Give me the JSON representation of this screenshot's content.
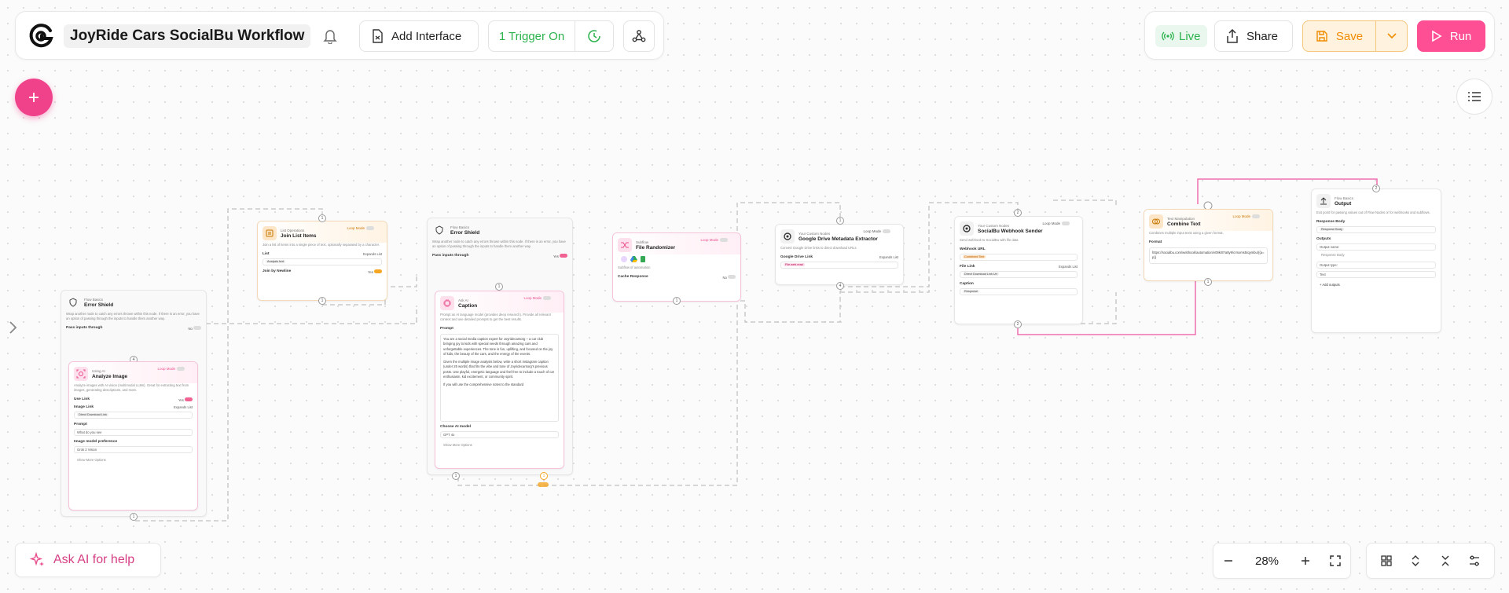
{
  "header": {
    "workflow_title": "JoyRide Cars SocialBu Workflow",
    "add_interface": "Add Interface",
    "trigger": "1 Trigger On",
    "live": "Live",
    "share": "Share",
    "save": "Save",
    "run": "Run"
  },
  "footer": {
    "ask_ai": "Ask AI for help",
    "zoom": "28%"
  },
  "colors": {
    "accent": "#f0418b",
    "live_green": "#2bb24c",
    "save_orange": "#f5a623",
    "run_pink": "#ff4f94"
  },
  "nodes": {
    "error_shield_1": {
      "category": "Flow Basics",
      "title": "Error Shield",
      "desc": "Wrap another node to catch any errors thrown within this node. If there is an error, you have an option of passing through the inputs to handle them another way.",
      "pass_label": "Pass inputs through",
      "pass_value": "No",
      "port": "4",
      "bottom_port": "1"
    },
    "analyze_image": {
      "category": "Using AI",
      "title": "Analyze Image",
      "loop": "Loop Mode",
      "desc": "Analyze images with AI vision (multimodal LLMs). Great for extracting text from images, generating descriptions, and more.",
      "use_link_label": "Use Link",
      "use_link_value": "Yes",
      "image_link_label": "Image Link",
      "expand": "Expands List",
      "image_link_chip": "Direct Download Link",
      "prompt_label": "Prompt",
      "prompt_value": "What do you see",
      "model_label": "Image model preference",
      "model_value": "Grok 2 Vision",
      "more": "Show More Options"
    },
    "join_list": {
      "category": "List Operations",
      "title": "Join List Items",
      "loop": "Loop Mode",
      "desc": "Join a list of items into a single piece of text, optionally separated by a character.",
      "list_label": "List",
      "expand": "Expands List",
      "list_chip": "Analysis text",
      "join_label": "Join by Newline",
      "join_value": "Yes",
      "port_top": "1",
      "port_bottom": "1"
    },
    "error_shield_2": {
      "category": "Flow Basics",
      "title": "Error Shield",
      "desc": "Wrap another node to catch any errors thrown within this node. If there is an error, you have an option of passing through the inputs to handle them another way.",
      "pass_label": "Pass inputs through",
      "pass_value": "Yes",
      "port": "1"
    },
    "caption": {
      "category": "Ask AI",
      "title": "Caption",
      "loop": "Loop Mode",
      "desc": "Prompt an AI language model (provides deep research). Provide all relevant context and use detailed prompts to get the best results.",
      "prompt_label": "Prompt",
      "prompt_p1": "You are a social media caption expert for Joyridecarsorg – a car club bringing joy to kids with special needs through amazing cars and unforgettable experiences. The tone is fun, uplifting, and focused on the joy of kids, the beauty of the cars, and the energy of the events.",
      "prompt_p2": "Given the multiple image analysis below, write a short Instagram caption (under 25 words) that fits the vibe and tone of Joyridecarsorg's previous posts. Use playful, energetic language and feel free to include a touch of car enthusiasm, kid excitement, or community spirit.",
      "prompt_p3": "If you will use the comprehensive notes to the standard",
      "model_label": "Choose AI model",
      "model_value": "GPT 4o",
      "more": "Show More Options",
      "port_left": "1",
      "port_right": "1"
    },
    "file_randomizer": {
      "category": "Subflow",
      "title": "File Randomizer",
      "loop": "Loop Mode",
      "sub": "Subflow of automation",
      "cache_label": "Cache Response",
      "cache_value": "No",
      "port": "1"
    },
    "gdrive": {
      "category": "Your Custom Nodes",
      "title": "Google Drive Metadata Extractor",
      "loop": "Loop Mode",
      "desc": "Convert Google Drive links to direct download URLs",
      "link_label": "Google Drive Link",
      "expand": "Expands List",
      "link_chip": "File.web.read",
      "port_top": "1",
      "port_bottom": "4"
    },
    "socialbu": {
      "category": "Your Custom Nodes",
      "title": "SocialBu Webhook Sender",
      "loop": "Loop Mode",
      "desc": "Send webhook to SocialBu with file data",
      "webhook_label": "Webhook URL",
      "webhook_chip": "Combined Text",
      "file_label": "File Link",
      "expand": "Expands List",
      "file_chip": "Direct Download Link Url",
      "caption_label": "Caption",
      "caption_chip": "Response",
      "port_top": "2",
      "port_bottom": "2"
    },
    "combine": {
      "category": "Text Manipulation",
      "title": "Combine Text",
      "loop": "Loop Mode",
      "desc": "Combines multiple input texts using a given format.",
      "format_label": "Format",
      "format_value": "https://socialbu.com/webhook/automation/v09kr8?a8y9/crmxms5/qymbu/{{a=p}}",
      "port_bottom": "1"
    },
    "output": {
      "category": "Flow Basics",
      "title": "Output",
      "desc": "Exit point for passing values out of Flow Nodes or for webhooks and subflows.",
      "resp_label": "Response Body",
      "resp_chip": "Response Body",
      "outputs_label": "Outputs",
      "name_label": "Output name:",
      "name_value": "Response Body",
      "type_label": "Output type:",
      "type_value": "Text",
      "add": "+ Add outputs",
      "port": "2"
    }
  }
}
